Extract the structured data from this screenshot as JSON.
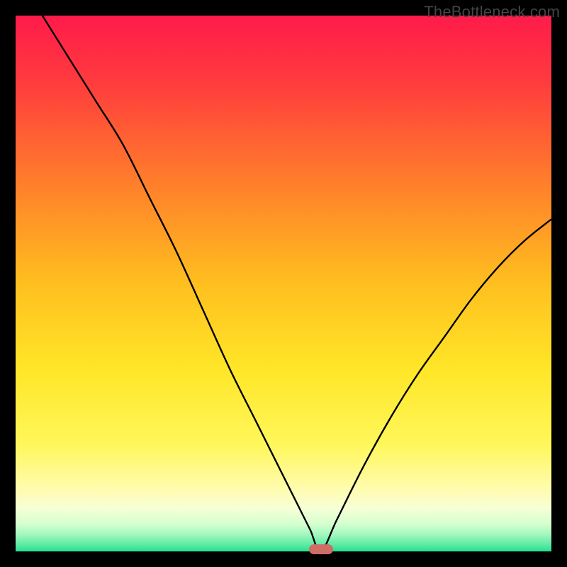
{
  "watermark": {
    "text": "TheBottleneck.com"
  },
  "colors": {
    "frame": "#000000",
    "watermark": "#444444",
    "curve": "#000000",
    "marker": "#cf6d66",
    "gradient_stops": [
      {
        "offset": 0.0,
        "color": "#ff1b4b"
      },
      {
        "offset": 0.12,
        "color": "#ff3a3e"
      },
      {
        "offset": 0.3,
        "color": "#ff7a2c"
      },
      {
        "offset": 0.5,
        "color": "#ffbf1f"
      },
      {
        "offset": 0.66,
        "color": "#ffe627"
      },
      {
        "offset": 0.8,
        "color": "#fff75a"
      },
      {
        "offset": 0.885,
        "color": "#fffcb0"
      },
      {
        "offset": 0.92,
        "color": "#f6ffd6"
      },
      {
        "offset": 0.948,
        "color": "#d6ffd0"
      },
      {
        "offset": 0.968,
        "color": "#a4f8be"
      },
      {
        "offset": 0.985,
        "color": "#66eca8"
      },
      {
        "offset": 1.0,
        "color": "#27e08f"
      }
    ]
  },
  "chart_data": {
    "type": "line",
    "title": "",
    "xlabel": "",
    "ylabel": "",
    "xlim": [
      0,
      100
    ],
    "ylim": [
      0,
      100
    ],
    "optimum_x": 57,
    "series": [
      {
        "name": "bottleneck-curve",
        "x": [
          5,
          10,
          15,
          20,
          25,
          30,
          35,
          40,
          45,
          50,
          53,
          55,
          57,
          60,
          65,
          70,
          75,
          80,
          85,
          90,
          95,
          100
        ],
        "y": [
          100,
          92,
          84,
          76,
          66,
          56,
          45,
          34,
          24,
          14,
          8,
          4,
          0,
          6,
          16,
          25,
          33,
          40,
          47,
          53,
          58,
          62
        ]
      }
    ],
    "marker": {
      "x": 57,
      "y": 0,
      "color": "#cf6d66"
    }
  }
}
